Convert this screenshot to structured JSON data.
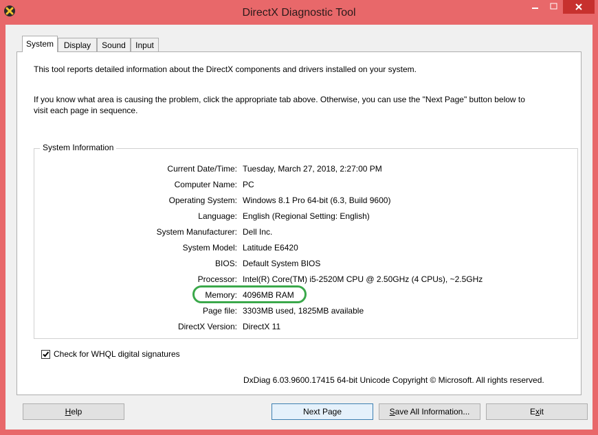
{
  "window": {
    "title": "DirectX Diagnostic Tool"
  },
  "tabs": [
    {
      "label": "System"
    },
    {
      "label": "Display"
    },
    {
      "label": "Sound"
    },
    {
      "label": "Input"
    }
  ],
  "intro": {
    "line1": "This tool reports detailed information about the DirectX components and drivers installed on your system.",
    "line2a": "If you know what area is causing the problem, click the appropriate tab above.  Otherwise, you can use the \"Next Page\" button below to",
    "line2b": "visit each page in sequence."
  },
  "system_info": {
    "group_title": "System Information",
    "rows": [
      {
        "label": "Current Date/Time:",
        "value": "Tuesday, March 27, 2018, 2:27:00 PM"
      },
      {
        "label": "Computer Name:",
        "value": "PC"
      },
      {
        "label": "Operating System:",
        "value": "Windows 8.1 Pro 64-bit (6.3, Build 9600)"
      },
      {
        "label": "Language:",
        "value": "English (Regional Setting: English)"
      },
      {
        "label": "System Manufacturer:",
        "value": "Dell Inc."
      },
      {
        "label": "System Model:",
        "value": "Latitude E6420"
      },
      {
        "label": "BIOS:",
        "value": "Default System BIOS"
      },
      {
        "label": "Processor:",
        "value": "Intel(R) Core(TM) i5-2520M CPU @ 2.50GHz (4 CPUs), ~2.5GHz"
      },
      {
        "label": "Memory:",
        "value": "4096MB RAM"
      },
      {
        "label": "Page file:",
        "value": "3303MB used, 1825MB available"
      },
      {
        "label": "DirectX Version:",
        "value": "DirectX 11"
      }
    ]
  },
  "whql_checkbox": {
    "label": "Check for WHQL digital signatures",
    "checked": true
  },
  "footer": "DxDiag 6.03.9600.17415 64-bit Unicode  Copyright © Microsoft. All rights reserved.",
  "buttons": {
    "help_pre": "",
    "help_key": "H",
    "help_post": "elp",
    "next": "Next Page",
    "save_pre": "",
    "save_key": "S",
    "save_post": "ave All Information...",
    "exit_pre": "E",
    "exit_key": "x",
    "exit_post": "it"
  },
  "colors": {
    "titlebar": "#e8686a",
    "close": "#c7312e",
    "highlight": "#3aa84a",
    "dialog": "#f0f0f0"
  }
}
